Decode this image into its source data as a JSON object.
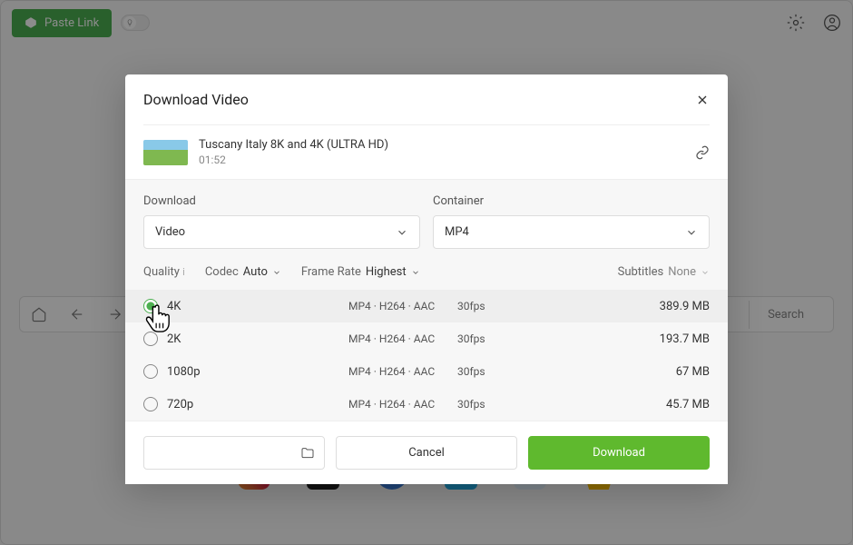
{
  "topbar": {
    "paste_label": "Paste Link"
  },
  "nav": {
    "search_label": "Search"
  },
  "modal": {
    "title": "Download Video",
    "video": {
      "title": "Tuscany Italy 8K and 4K (ULTRA HD)",
      "duration": "01:52"
    },
    "dropdowns": {
      "download": {
        "label": "Download",
        "value": "Video"
      },
      "container": {
        "label": "Container",
        "value": "MP4"
      }
    },
    "filters": {
      "quality_label": "Quality",
      "codec_label": "Codec",
      "codec_value": "Auto",
      "framerate_label": "Frame Rate",
      "framerate_value": "Highest",
      "subtitles_label": "Subtitles",
      "subtitles_value": "None"
    },
    "quality_options": [
      {
        "name": "4K",
        "format": "MP4 · H264 · AAC",
        "fps": "30fps",
        "size": "389.9 MB",
        "selected": true
      },
      {
        "name": "2K",
        "format": "MP4 · H264 · AAC",
        "fps": "30fps",
        "size": "193.7 MB",
        "selected": false
      },
      {
        "name": "1080p",
        "format": "MP4 · H264 · AAC",
        "fps": "30fps",
        "size": "67 MB",
        "selected": false
      },
      {
        "name": "720p",
        "format": "MP4 · H264 · AAC",
        "fps": "30fps",
        "size": "45.7 MB",
        "selected": false
      }
    ],
    "buttons": {
      "cancel": "Cancel",
      "download": "Download"
    }
  }
}
